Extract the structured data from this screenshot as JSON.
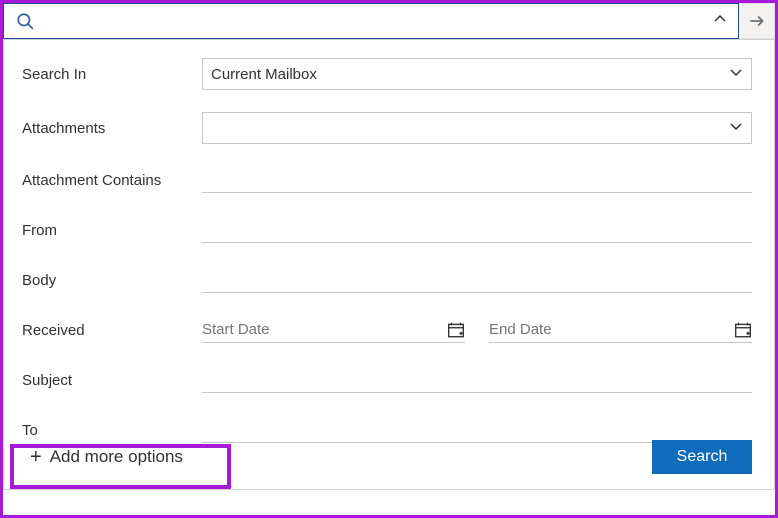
{
  "search": {
    "value": "",
    "placeholder": ""
  },
  "fields": {
    "search_in": {
      "label": "Search In",
      "value": "Current Mailbox"
    },
    "attachments": {
      "label": "Attachments",
      "value": ""
    },
    "attachment_contains": {
      "label": "Attachment Contains",
      "value": ""
    },
    "from": {
      "label": "From",
      "value": ""
    },
    "body": {
      "label": "Body",
      "value": ""
    },
    "received": {
      "label": "Received",
      "start_placeholder": "Start Date",
      "end_placeholder": "End Date"
    },
    "subject": {
      "label": "Subject",
      "value": ""
    },
    "to": {
      "label": "To",
      "value": ""
    }
  },
  "footer": {
    "add_more": "Add more options",
    "search_button": "Search"
  }
}
